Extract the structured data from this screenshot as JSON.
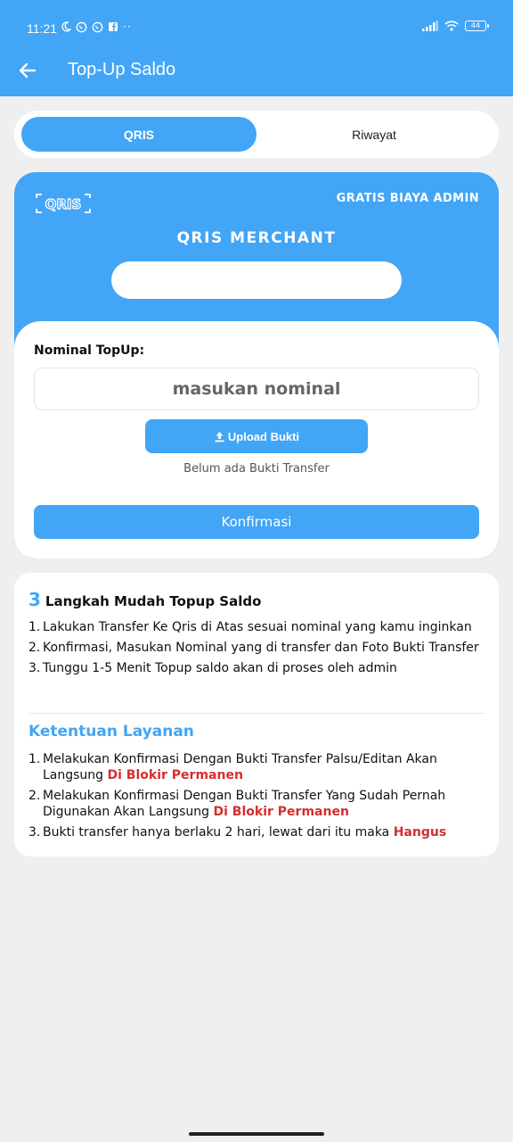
{
  "status_bar": {
    "time": "11:21",
    "battery": "44"
  },
  "app_bar": {
    "title": "Top-Up Saldo"
  },
  "tabs": [
    {
      "label": "QRIS"
    },
    {
      "label": "Riwayat"
    }
  ],
  "qris_card": {
    "logo_text": "QRIS",
    "badge": "GRATIS BIAYA ADMIN",
    "merchant_label": "QRIS MERCHANT",
    "merchant_value": ""
  },
  "form": {
    "nominal_label": "Nominal TopUp:",
    "nominal_placeholder": "masukan nominal",
    "nominal_value": "",
    "upload_label": "Upload Bukti",
    "upload_status": "Belum ada Bukti Transfer",
    "confirm_label": "Konfirmasi"
  },
  "steps": {
    "number": "3",
    "title": "Langkah Mudah Topup Saldo",
    "items": [
      {
        "num": "1.",
        "text": "Lakukan Transfer Ke Qris di Atas sesuai nominal yang kamu inginkan"
      },
      {
        "num": "2.",
        "text": "Konfirmasi, Masukan Nominal yang di transfer dan Foto Bukti Transfer"
      },
      {
        "num": "3.",
        "text": "Tunggu 1-5 Menit Topup saldo akan di proses oleh admin"
      }
    ]
  },
  "terms": {
    "title": "Ketentuan Layanan",
    "items": [
      {
        "num": "1.",
        "text": "Melakukan Konfirmasi Dengan Bukti Transfer Palsu/Editan Akan Langsung ",
        "emphasis": "Di Blokir Permanen"
      },
      {
        "num": "2.",
        "text": "Melakukan Konfirmasi Dengan Bukti Transfer Yang Sudah Pernah Digunakan Akan Langsung ",
        "emphasis": "Di Blokir Permanen"
      },
      {
        "num": "3.",
        "text": "Bukti transfer hanya berlaku 2 hari, lewat dari itu maka ",
        "emphasis": "Hangus"
      }
    ]
  },
  "colors": {
    "primary": "#42a5f5",
    "danger": "#d32f2f",
    "background": "#efefef"
  },
  "icons": [
    "back-arrow-icon",
    "upload-icon",
    "moon-icon",
    "whatsapp-icon",
    "facebook-icon",
    "signal-icon",
    "wifi-icon",
    "battery-icon"
  ]
}
